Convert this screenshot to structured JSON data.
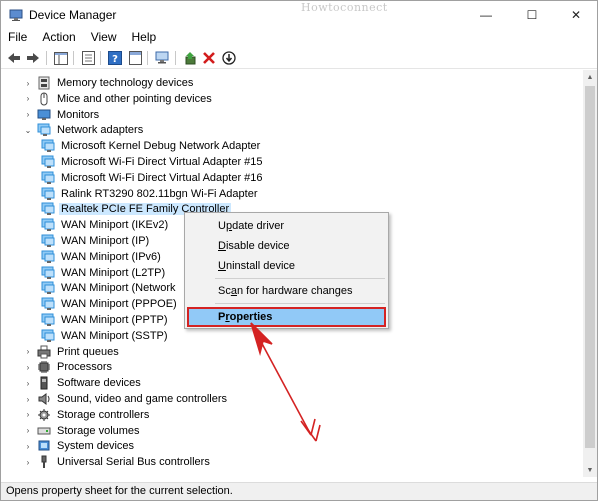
{
  "window": {
    "title": "Device Manager",
    "watermark": "Howtoconnect",
    "controls": {
      "minimize": "—",
      "maximize": "☐",
      "close": "✕"
    }
  },
  "menu": [
    {
      "label": "File"
    },
    {
      "label": "Action"
    },
    {
      "label": "View"
    },
    {
      "label": "Help"
    }
  ],
  "tree": {
    "items": [
      {
        "label": "Memory technology devices",
        "level": 1,
        "expander": "›",
        "icon": "memory-icon"
      },
      {
        "label": "Mice and other pointing devices",
        "level": 1,
        "expander": "›",
        "icon": "mouse-icon"
      },
      {
        "label": "Monitors",
        "level": 1,
        "expander": "›",
        "icon": "monitor-icon"
      },
      {
        "label": "Network adapters",
        "level": 1,
        "expander": "⌄",
        "icon": "network-icon"
      },
      {
        "label": "Microsoft Kernel Debug Network Adapter",
        "level": 2,
        "icon": "network-icon"
      },
      {
        "label": "Microsoft Wi-Fi Direct Virtual Adapter #15",
        "level": 2,
        "icon": "network-icon"
      },
      {
        "label": "Microsoft Wi-Fi Direct Virtual Adapter #16",
        "level": 2,
        "icon": "network-icon"
      },
      {
        "label": "Ralink RT3290 802.11bgn Wi-Fi Adapter",
        "level": 2,
        "icon": "network-icon"
      },
      {
        "label": "Realtek PCIe FE Family Controller",
        "level": 2,
        "icon": "network-icon",
        "selected": true
      },
      {
        "label": "WAN Miniport (IKEv2)",
        "level": 2,
        "icon": "network-icon"
      },
      {
        "label": "WAN Miniport (IP)",
        "level": 2,
        "icon": "network-icon"
      },
      {
        "label": "WAN Miniport (IPv6)",
        "level": 2,
        "icon": "network-icon"
      },
      {
        "label": "WAN Miniport (L2TP)",
        "level": 2,
        "icon": "network-icon"
      },
      {
        "label": "WAN Miniport (Network",
        "level": 2,
        "icon": "network-icon"
      },
      {
        "label": "WAN Miniport (PPPOE)",
        "level": 2,
        "icon": "network-icon"
      },
      {
        "label": "WAN Miniport (PPTP)",
        "level": 2,
        "icon": "network-icon"
      },
      {
        "label": "WAN Miniport (SSTP)",
        "level": 2,
        "icon": "network-icon"
      },
      {
        "label": "Print queues",
        "level": 1,
        "expander": "›",
        "icon": "printer-icon"
      },
      {
        "label": "Processors",
        "level": 1,
        "expander": "›",
        "icon": "processor-icon"
      },
      {
        "label": "Software devices",
        "level": 1,
        "expander": "›",
        "icon": "software-device-icon"
      },
      {
        "label": "Sound, video and game controllers",
        "level": 1,
        "expander": "›",
        "icon": "speaker-icon"
      },
      {
        "label": "Storage controllers",
        "level": 1,
        "expander": "›",
        "icon": "storage-controller-icon"
      },
      {
        "label": "Storage volumes",
        "level": 1,
        "expander": "›",
        "icon": "storage-volume-icon"
      },
      {
        "label": "System devices",
        "level": 1,
        "expander": "›",
        "icon": "system-icon"
      },
      {
        "label": "Universal Serial Bus controllers",
        "level": 1,
        "expander": "›",
        "icon": "usb-icon"
      }
    ]
  },
  "context_menu": {
    "items": [
      {
        "label": "Update driver",
        "accel": "p"
      },
      {
        "label": "Disable device",
        "accel": "D"
      },
      {
        "label": "Uninstall device",
        "accel": "U"
      },
      {
        "separator": true
      },
      {
        "label": "Scan for hardware changes",
        "accel": "a"
      },
      {
        "separator": true
      },
      {
        "label": "Properties",
        "accel": "r",
        "highlighted": true
      }
    ]
  },
  "status": {
    "text": "Opens property sheet for the current selection."
  },
  "colors": {
    "selection": "#cce8ff",
    "menu_highlight": "#91c9f7",
    "annotation_red": "#d42323",
    "network_icon": "#2f8fd8"
  }
}
